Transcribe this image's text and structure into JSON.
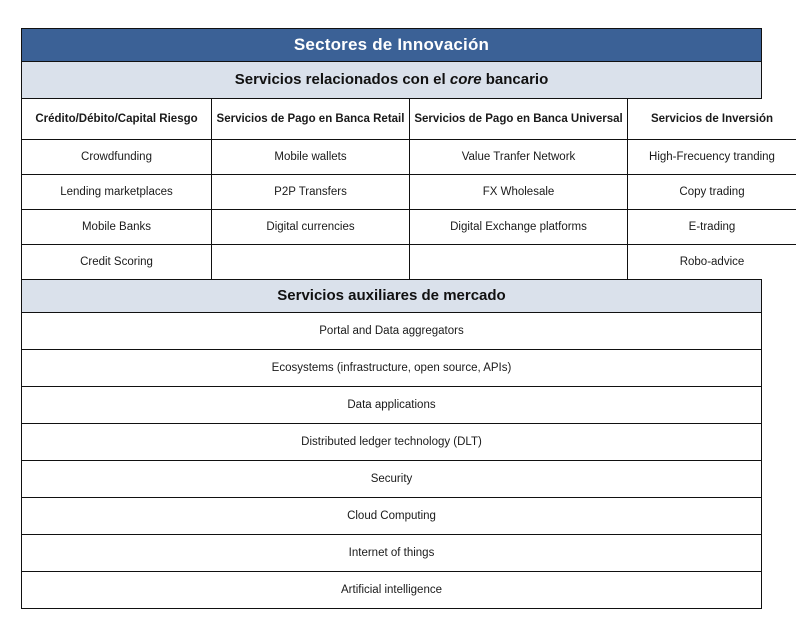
{
  "title": "Sectores de Innovación",
  "colors": {
    "header_blue": "#3b6196",
    "band_blue": "#dae1eb",
    "border": "#111111",
    "text": "#111111",
    "header_text": "#ffffff"
  },
  "core_section": {
    "band_prefix": "Servicios relacionados con el ",
    "band_italic": "core",
    "band_suffix": " bancario",
    "columns": [
      "Crédito/Débito/Capital Riesgo",
      "Servicios de Pago en Banca Retail",
      "Servicios de Pago en Banca Universal",
      "Servicios de Inversión"
    ],
    "rows": [
      [
        "Crowdfunding",
        "Mobile wallets",
        "Value Tranfer Network",
        "High-Frecuency tranding"
      ],
      [
        "Lending marketplaces",
        "P2P Transfers",
        "FX Wholesale",
        "Copy trading"
      ],
      [
        "Mobile Banks",
        "Digital currencies",
        "Digital Exchange platforms",
        "E-trading"
      ],
      [
        "Credit Scoring",
        "",
        "",
        "Robo-advice"
      ]
    ]
  },
  "aux_section": {
    "band": "Servicios auxiliares de mercado",
    "items": [
      "Portal and Data aggregators",
      "Ecosystems (infrastructure, open source, APIs)",
      "Data applications",
      "Distributed ledger technology (DLT)",
      "Security",
      "Cloud Computing",
      "Internet of things",
      "Artificial intelligence"
    ]
  }
}
